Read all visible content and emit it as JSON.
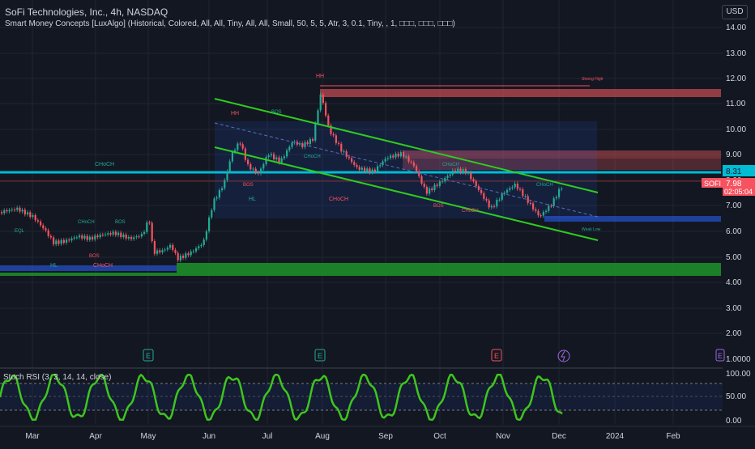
{
  "header": {
    "title": "SoFi Technologies, Inc., 4h, NASDAQ",
    "indicator": "Smart Money Concepts [LuxAlgo] (Historical, Colored, All, All, Tiny, All, All, Small, 50, 5, 5, Atr, 3, 0.1, Tiny, , 1, □□□, □□□, □□□)",
    "currency": "USD"
  },
  "price_axis": {
    "ticks": [
      "14.00",
      "13.00",
      "12.00",
      "11.00",
      "10.00",
      "9.00",
      "8.00",
      "7.00",
      "6.00",
      "5.00",
      "4.00",
      "3.00",
      "2.00",
      "1.0000"
    ],
    "labels": {
      "level": "8.31",
      "symbol": "SOFI",
      "price": "7.98",
      "countdown": "02:05:04"
    }
  },
  "rsi": {
    "legend": "Stoch RSI (3, 3, 14, 14, close)",
    "ticks": [
      "100.00",
      "50.00",
      "0.00"
    ]
  },
  "time_axis": [
    "Mar",
    "Apr",
    "May",
    "Jun",
    "Jul",
    "Aug",
    "Sep",
    "Oct",
    "Nov",
    "Dec",
    "2024",
    "Feb"
  ],
  "annotations": {
    "hh1": "HH",
    "hh2": "HH",
    "hl": "HL",
    "hl2": "HL",
    "choch": "CHoCH",
    "bos": "BOS",
    "eql": "EQL",
    "strong_high": "Strong High",
    "weak_low": "Weak Low",
    "earnings": "E"
  },
  "colors": {
    "bg": "#131722",
    "up": "#22ab94",
    "down": "#f7525f",
    "channel": "#2ecc1f",
    "level": "#00bcd4",
    "red_zone": "#c04a4f",
    "blue_zone": "#2962ff",
    "green_zone": "#1e8c2a",
    "rsi": "#3ec51f"
  }
}
